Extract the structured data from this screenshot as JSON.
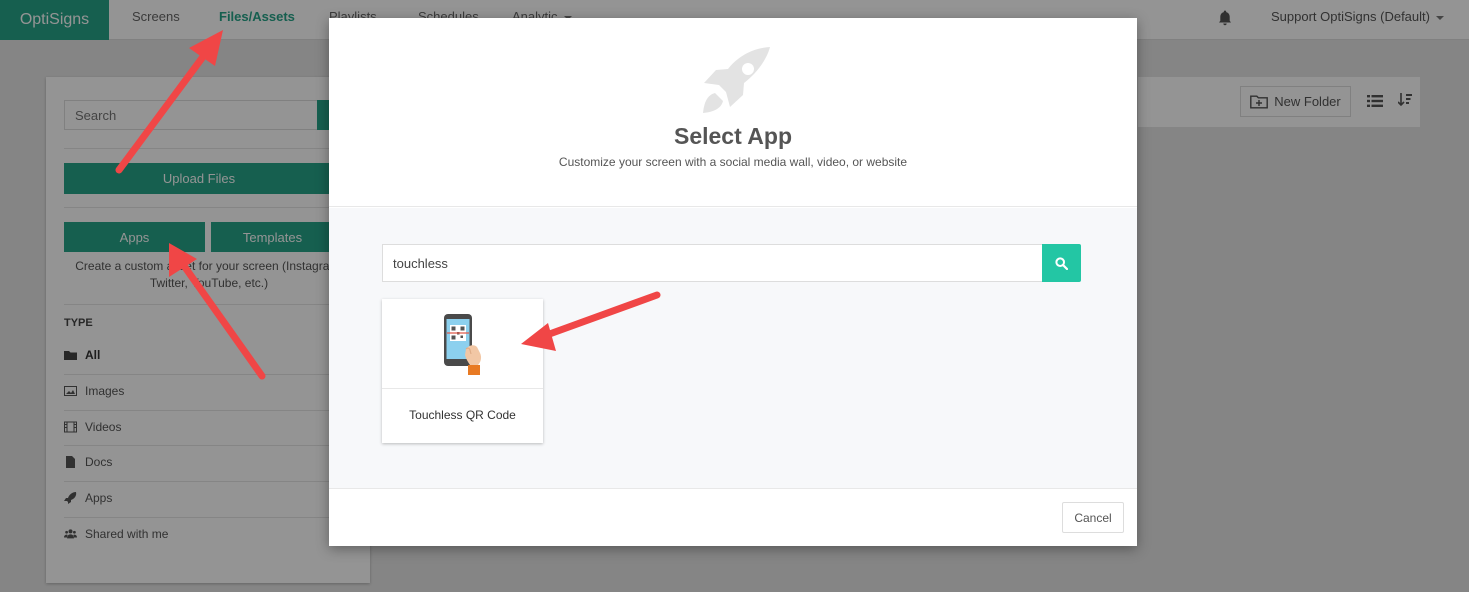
{
  "colors": {
    "brand": "#26a489",
    "search_button": "#23c6a4",
    "annotation_arrow": "#f04646"
  },
  "nav": {
    "logo": "OptiSigns",
    "items": [
      "Screens",
      "Files/Assets",
      "Playlists",
      "Schedules",
      "Analytic"
    ],
    "account": "Support OptiSigns (Default)"
  },
  "sidebar": {
    "search_placeholder": "Search",
    "upload_label": "Upload Files",
    "apps_label": "Apps",
    "templates_label": "Templates",
    "description": "Create a custom asset for your screen (Instagram, Twitter, YouTube, etc.)",
    "type_heading": "TYPE",
    "types": [
      "All",
      "Images",
      "Videos",
      "Docs",
      "Apps",
      "Shared with me"
    ]
  },
  "toolbar": {
    "new_folder_label": "New Folder"
  },
  "modal": {
    "title": "Select App",
    "subtitle": "Customize your screen with a social media wall, video, or website",
    "search_value": "touchless",
    "result_label": "Touchless QR Code",
    "cancel_label": "Cancel"
  },
  "icons": [
    "bell-icon",
    "rocket-icon",
    "search-icon",
    "qr-phone-icon",
    "folder-plus-icon",
    "list-view-icon",
    "sort-icon",
    "folder-icon",
    "image-icon",
    "film-icon",
    "doc-icon",
    "users-icon"
  ]
}
